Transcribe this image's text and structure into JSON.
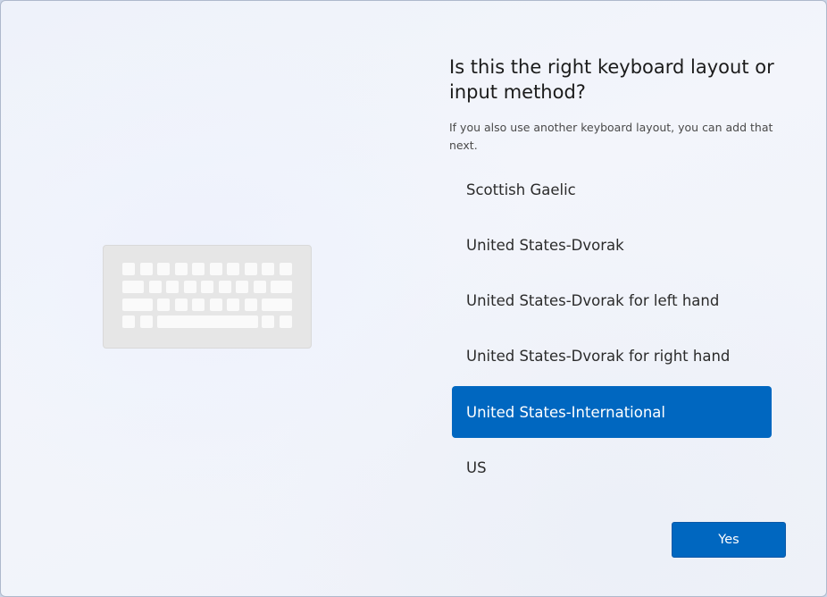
{
  "page": {
    "title": "Is this the right keyboard layout or input method?",
    "subtitle": "If you also use another keyboard layout, you can add that next."
  },
  "layouts": {
    "items": [
      {
        "label": "Scottish Gaelic",
        "selected": false
      },
      {
        "label": "United States-Dvorak",
        "selected": false
      },
      {
        "label": "United States-Dvorak for left hand",
        "selected": false
      },
      {
        "label": "United States-Dvorak for right hand",
        "selected": false
      },
      {
        "label": "United States-International",
        "selected": true
      },
      {
        "label": "US",
        "selected": false
      }
    ]
  },
  "actions": {
    "yes_label": "Yes"
  },
  "illustration": {
    "icon": "keyboard-icon"
  },
  "colors": {
    "accent": "#0067c0",
    "selected_text": "#ffffff",
    "keyboard_body": "#e6e6e6",
    "key": "#fafafa"
  }
}
